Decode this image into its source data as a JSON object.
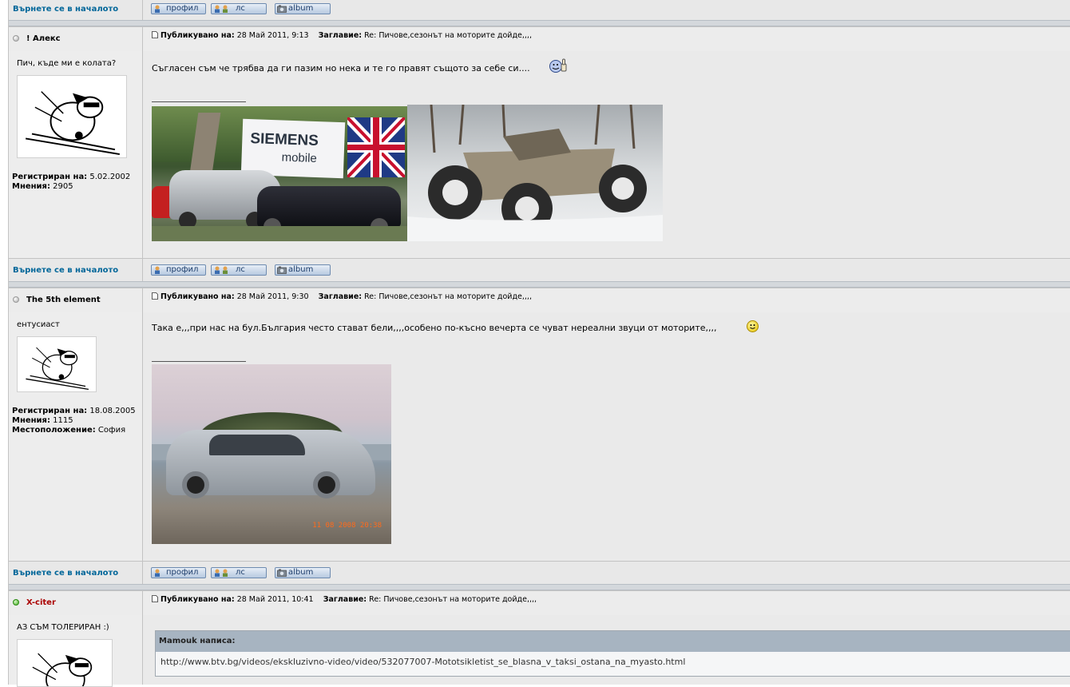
{
  "common": {
    "back_to_top": "Върнете се в началото",
    "btn_profile": "профил",
    "btn_pm": "лс",
    "btn_album": "album",
    "posted_label": "Публикувано на:",
    "subject_label": "Заглавие:",
    "registered_label": "Регистриран на:",
    "posts_label": "Мнения:",
    "location_label": "Местоположение:"
  },
  "posts": [
    {
      "username": "! Алекс",
      "online": false,
      "rank": "Пич, къде ми е колата?",
      "registered": "5.02.2002",
      "post_count": "2905",
      "posted": "28 Май 2011, 9:13",
      "subject": "Re: Пичове,сезонът на моторите дойде,,,,",
      "message": "Съгласен съм че трябва да ги пазим но нека и те го правят същото за себе си....",
      "images": [
        "cars with SIEMENS mobile banner",
        "ATV quad in snow"
      ],
      "banner_text": "SIEMENS",
      "banner_sub": "mobile"
    },
    {
      "username": "The 5th element",
      "online": false,
      "rank": "ентусиаст",
      "registered": "18.08.2005",
      "post_count": "1115",
      "location": "София",
      "posted": "28 Май 2011, 9:30",
      "subject": "Re: Пичове,сезонът на моторите дойде,,,,",
      "message": "Така е,,,при нас на бул.България често стават бели,,,,особено по-късно вечерта се чуват нереални звуци от моторите,,,,",
      "photo_stamp": "11 08 2008 20:38"
    },
    {
      "username": "X-citer",
      "online": true,
      "rank": "АЗ СЪМ ТОЛЕРИРАН :)",
      "posted": "28 Май 2011, 10:41",
      "subject": "Re: Пичове,сезонът на моторите дойде,,,,",
      "quote_author": "Mamouk написа:",
      "quote_text": "http://www.btv.bg/videos/ekskluzivno-video/video/532077007-Mototsikletist_se_blasna_v_taksi_ostana_na_myasto.html"
    }
  ],
  "colors": {
    "link": "#006699",
    "online": "#3fae1e",
    "username_online": "#aa0000"
  }
}
